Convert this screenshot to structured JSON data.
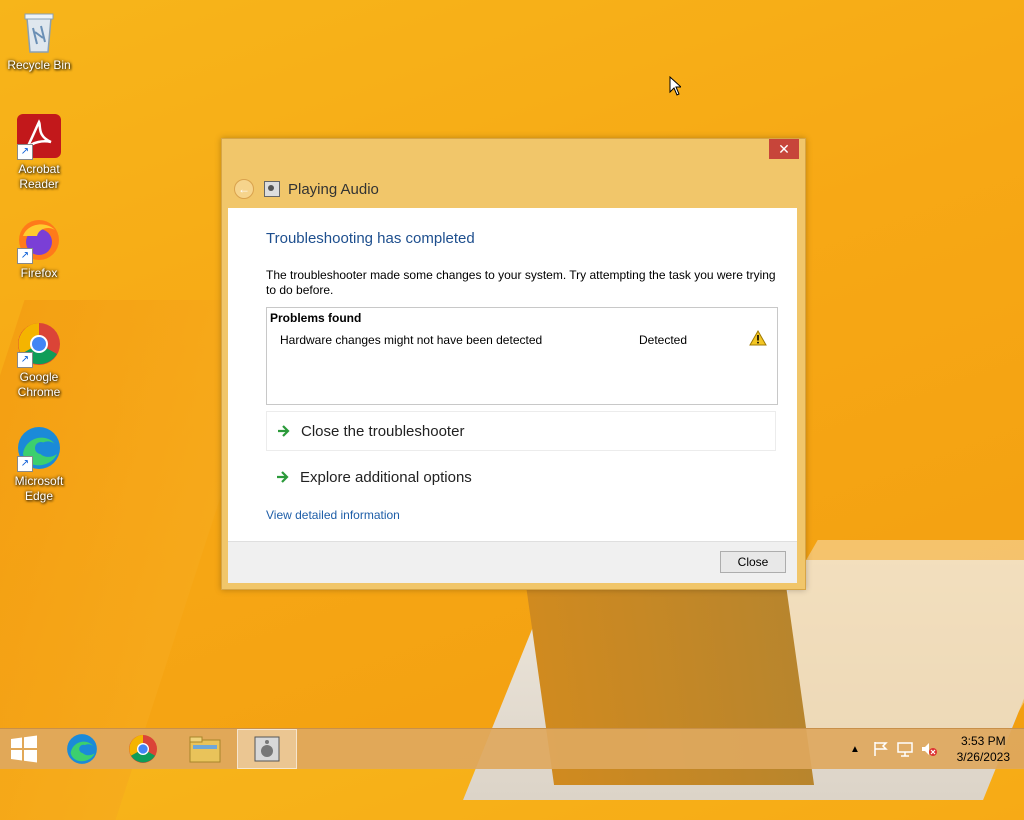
{
  "desktop": {
    "icons": [
      {
        "label": "Recycle Bin"
      },
      {
        "label": "Acrobat Reader"
      },
      {
        "label": "Firefox"
      },
      {
        "label": "Google Chrome"
      },
      {
        "label": "Microsoft Edge"
      }
    ]
  },
  "dialog": {
    "close_glyph": "✕",
    "header_title": "Playing Audio",
    "heading": "Troubleshooting has completed",
    "description": "The troubleshooter made some changes to your system. Try attempting the task you were trying to do before.",
    "problems": {
      "title": "Problems found",
      "rows": [
        {
          "text": "Hardware changes might not have been detected",
          "status": "Detected"
        }
      ]
    },
    "options": [
      {
        "label": "Close the troubleshooter"
      },
      {
        "label": "Explore additional options"
      }
    ],
    "link": "View detailed information",
    "close_button": "Close"
  },
  "taskbar": {
    "clock_time": "3:53 PM",
    "clock_date": "3/26/2023"
  }
}
